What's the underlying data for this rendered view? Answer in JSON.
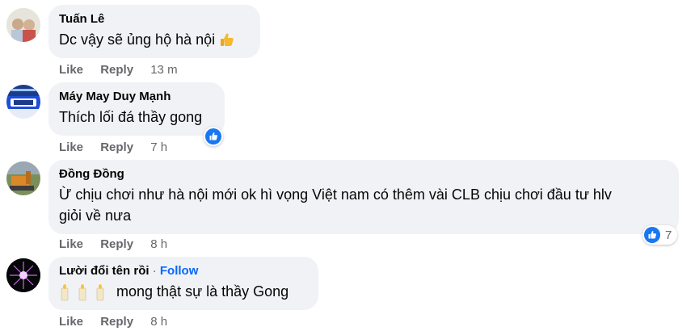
{
  "comments": [
    {
      "author": "Tuấn Lê",
      "text": "Dc vậy sẽ ủng hộ hà nội",
      "emoji": "thumbs-up-icon",
      "actions": {
        "like": "Like",
        "reply": "Reply",
        "time": "13 m"
      }
    },
    {
      "author": "Máy May Duy Mạnh",
      "text": "Thích lối đá thầy gong",
      "reaction": {
        "icon": "like-reaction-icon"
      },
      "actions": {
        "like": "Like",
        "reply": "Reply",
        "time": "7 h"
      }
    },
    {
      "author": "Đồng Đồng",
      "text_line1": "Ừ chịu chơi như hà nội mới ok hì vọng Việt nam có thêm vài CLB chịu chơi đầu tư hlv",
      "text_line2": "giỏi về nưa",
      "reaction": {
        "icon": "like-reaction-icon",
        "count": "7"
      },
      "actions": {
        "like": "Like",
        "reply": "Reply",
        "time": "8 h"
      }
    },
    {
      "author": "Lười đổi tên rồi",
      "separator": " · ",
      "follow": "Follow",
      "emoji": "candle-icon",
      "text": "mong thật sự là thầy Gong",
      "actions": {
        "like": "Like",
        "reply": "Reply",
        "time": "8 h"
      }
    }
  ],
  "colors": {
    "bubble": "#f0f2f5",
    "secondary_text": "#65676b",
    "link_blue": "#0866ff",
    "like_blue": "#1877f2"
  }
}
